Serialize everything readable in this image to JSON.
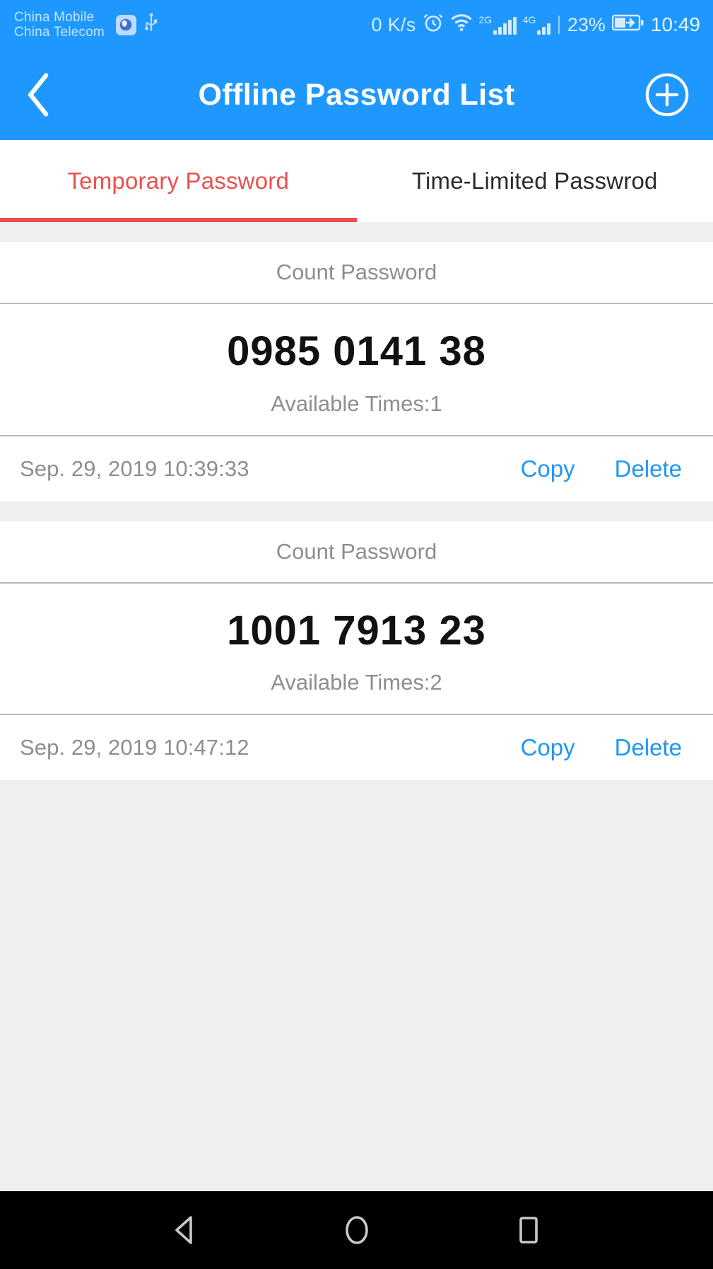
{
  "statusbar": {
    "carrier_primary": "China Mobile",
    "carrier_secondary": "China Telecom",
    "app_icon": "browser-icon",
    "usb_icon": "usb-icon",
    "network_speed": "0 K/s",
    "alarm_icon": "alarm-clock-icon",
    "wifi_icon": "wifi-icon",
    "signal1_label": "2G",
    "signal2_label": "4G",
    "battery_percent": "23%",
    "battery_icon": "charging-battery-icon",
    "time": "10:49"
  },
  "appbar": {
    "back_icon": "chevron-left-icon",
    "title": "Offline Password List",
    "add_icon": "plus-circle-icon"
  },
  "tabs": [
    {
      "label": "Temporary Password",
      "active": true
    },
    {
      "label": "Time-Limited Passwrod",
      "active": false
    }
  ],
  "list": {
    "cards": [
      {
        "header": "Count Password",
        "code": "0985 0141 38",
        "available_times": "Available Times:1",
        "date": "Sep. 29, 2019 10:39:33",
        "copy_label": "Copy",
        "delete_label": "Delete"
      },
      {
        "header": "Count Password",
        "code": "1001 7913 23",
        "available_times": "Available Times:2",
        "date": "Sep. 29, 2019 10:47:12",
        "copy_label": "Copy",
        "delete_label": "Delete"
      }
    ]
  },
  "navbar": {
    "back_icon": "nav-back-triangle-icon",
    "home_icon": "nav-home-circle-icon",
    "recents_icon": "nav-recents-square-icon"
  },
  "colors": {
    "brand_blue": "#1E98FF",
    "accent_red": "#e8514a",
    "action_blue": "#2196f3",
    "page_bg": "#efefef",
    "muted_text": "#8e8e8e"
  }
}
